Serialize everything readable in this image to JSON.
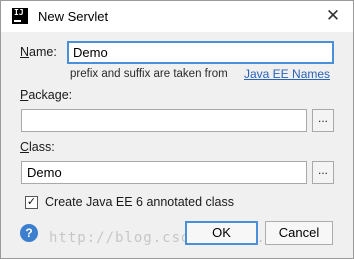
{
  "window": {
    "title": "New Servlet",
    "app_icon_letter": "IJ"
  },
  "name_field": {
    "label_mnemonic": "N",
    "label_rest": "ame:",
    "value": "Demo",
    "hint": "prefix and suffix are taken from",
    "link": "Java EE Names"
  },
  "package_field": {
    "label_mnemonic": "P",
    "label_rest": "ackage:",
    "value": "",
    "browse_label": "..."
  },
  "class_field": {
    "label_mnemonic": "C",
    "label_rest": "lass:",
    "value": "Demo",
    "browse_label": "..."
  },
  "annotated_checkbox": {
    "label": "Create Java EE 6 annotated class",
    "checked": true,
    "check_glyph": "✓"
  },
  "buttons": {
    "help": "?",
    "ok": "OK",
    "cancel": "Cancel"
  },
  "watermark": "http://blog.csdn.net/..."
}
